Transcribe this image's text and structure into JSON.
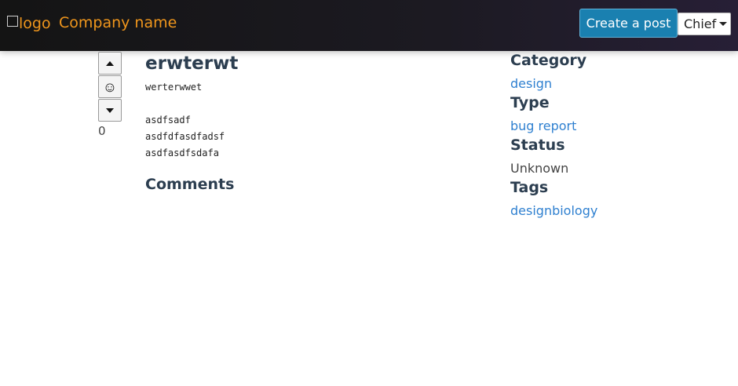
{
  "header": {
    "logo_alt": "logo",
    "company_name": "Company name",
    "create_post_label": "Create a post",
    "user_menu_label": "Chief"
  },
  "vote": {
    "count": "0"
  },
  "post": {
    "title": "erwterwt",
    "body_lines": [
      "werterwwet",
      "",
      "asdfsadf",
      "asdfdfasdfadsf",
      "asdfasdfsdafa"
    ],
    "comments_heading": "Comments"
  },
  "sidebar": {
    "category_heading": "Category",
    "category_value": "design",
    "type_heading": "Type",
    "type_value": "bug report",
    "status_heading": "Status",
    "status_value": "Unknown",
    "tags_heading": "Tags",
    "tags_value": "designbiology"
  },
  "colors": {
    "brand": "#f0961c",
    "primary_button": "#1a80b0",
    "link": "#2f80d0",
    "heading": "#2c3e50"
  }
}
